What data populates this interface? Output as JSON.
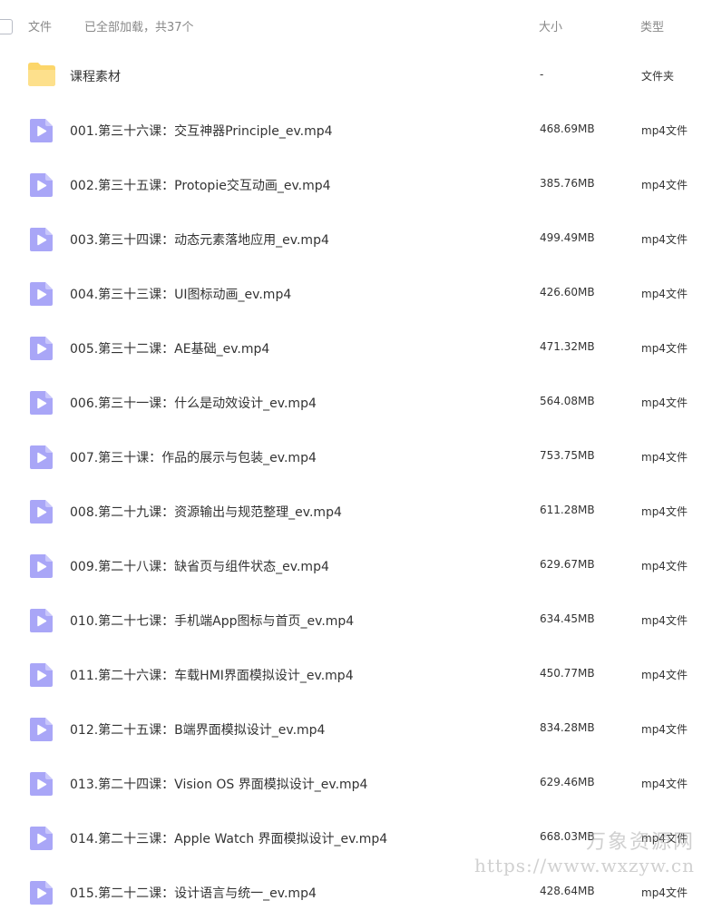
{
  "header": {
    "col_name": "文件",
    "loaded_status": "已全部加载，共37个",
    "col_size": "大小",
    "col_type": "类型"
  },
  "colors": {
    "video_icon": "#a9a6f7",
    "folder_icon": "#fcd66a"
  },
  "files": [
    {
      "icon": "folder-icon",
      "name": "课程素材",
      "size": "-",
      "type": "文件夹"
    },
    {
      "icon": "video-file-icon",
      "name": "001.第三十六课：交互神器Principle_ev.mp4",
      "size": "468.69MB",
      "type": "mp4文件"
    },
    {
      "icon": "video-file-icon",
      "name": "002.第三十五课：Protopie交互动画_ev.mp4",
      "size": "385.76MB",
      "type": "mp4文件"
    },
    {
      "icon": "video-file-icon",
      "name": "003.第三十四课：动态元素落地应用_ev.mp4",
      "size": "499.49MB",
      "type": "mp4文件"
    },
    {
      "icon": "video-file-icon",
      "name": "004.第三十三课：UI图标动画_ev.mp4",
      "size": "426.60MB",
      "type": "mp4文件"
    },
    {
      "icon": "video-file-icon",
      "name": "005.第三十二课：AE基础_ev.mp4",
      "size": "471.32MB",
      "type": "mp4文件"
    },
    {
      "icon": "video-file-icon",
      "name": "006.第三十一课：什么是动效设计_ev.mp4",
      "size": "564.08MB",
      "type": "mp4文件"
    },
    {
      "icon": "video-file-icon",
      "name": "007.第三十课：作品的展示与包装_ev.mp4",
      "size": "753.75MB",
      "type": "mp4文件"
    },
    {
      "icon": "video-file-icon",
      "name": "008.第二十九课：资源输出与规范整理_ev.mp4",
      "size": "611.28MB",
      "type": "mp4文件"
    },
    {
      "icon": "video-file-icon",
      "name": "009.第二十八课：缺省页与组件状态_ev.mp4",
      "size": "629.67MB",
      "type": "mp4文件"
    },
    {
      "icon": "video-file-icon",
      "name": "010.第二十七课：手机端App图标与首页_ev.mp4",
      "size": "634.45MB",
      "type": "mp4文件"
    },
    {
      "icon": "video-file-icon",
      "name": "011.第二十六课：车载HMI界面模拟设计_ev.mp4",
      "size": "450.77MB",
      "type": "mp4文件"
    },
    {
      "icon": "video-file-icon",
      "name": "012.第二十五课：B端界面模拟设计_ev.mp4",
      "size": "834.28MB",
      "type": "mp4文件"
    },
    {
      "icon": "video-file-icon",
      "name": "013.第二十四课：Vision OS 界面模拟设计_ev.mp4",
      "size": "629.46MB",
      "type": "mp4文件"
    },
    {
      "icon": "video-file-icon",
      "name": "014.第二十三课：Apple Watch 界面模拟设计_ev.mp4",
      "size": "668.03MB",
      "type": "mp4文件"
    },
    {
      "icon": "video-file-icon",
      "name": "015.第二十二课：设计语言与统一_ev.mp4",
      "size": "428.64MB",
      "type": "mp4文件"
    }
  ],
  "watermark": {
    "name": "万象资源网",
    "url": "https://www.wxzyw.cn"
  }
}
